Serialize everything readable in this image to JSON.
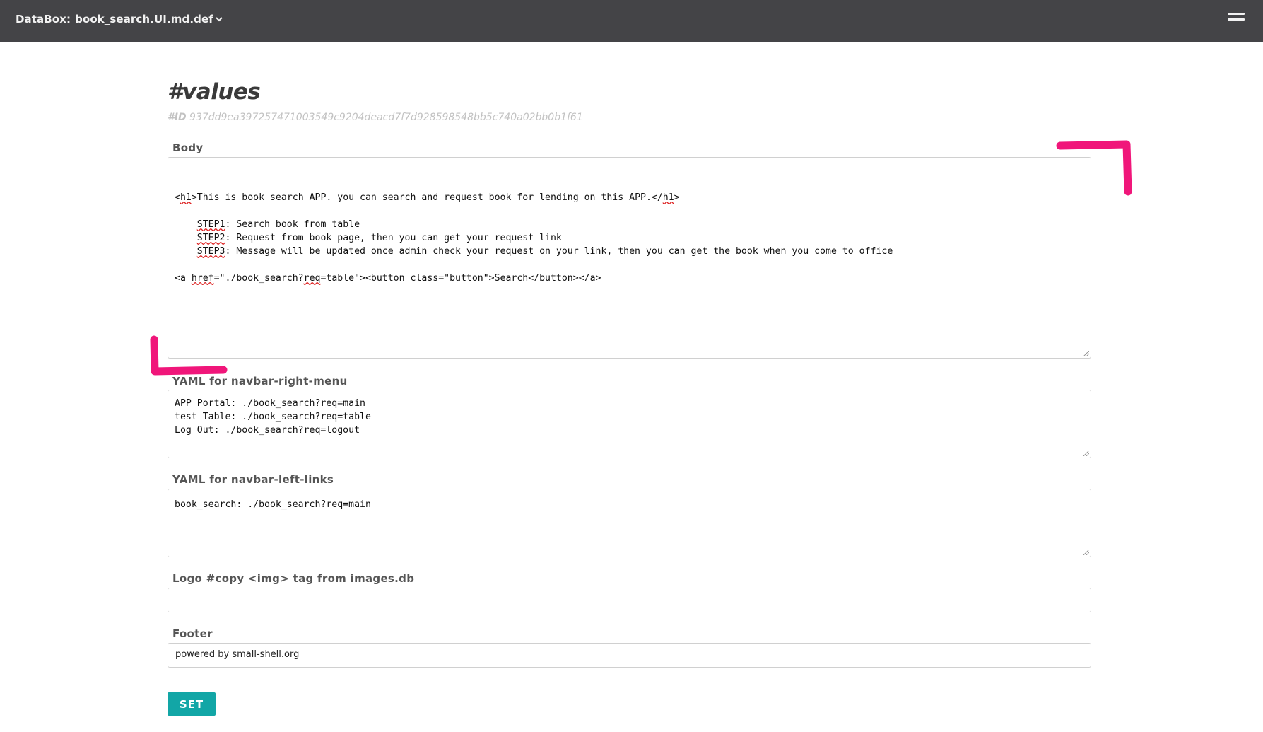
{
  "header": {
    "app_label": "DataBox:",
    "databox_name": "book_search.UI.md.def",
    "caret": "⌄"
  },
  "page": {
    "title": "#values",
    "id_label": "#ID",
    "id_value": "937dd9ea397257471003549c9204deacd7f7d928598548bb5c740a02bb0b1f61"
  },
  "fields": {
    "body": {
      "label": "Body",
      "lines": [
        [
          "<",
          {
            "w": "h1"
          },
          ">This is book search APP. you can search and request book for lending on this APP.</",
          {
            "w": "h1"
          },
          ">"
        ],
        [
          ""
        ],
        [
          "    ",
          {
            "w": "STEP1"
          },
          ": Search book from table"
        ],
        [
          "    ",
          {
            "w": "STEP2"
          },
          ": Request from book page, then you can get your request link"
        ],
        [
          "    ",
          {
            "w": "STEP3"
          },
          ": Message will be updated once admin check your request on your link, then you can get the book when you come to office"
        ],
        [
          ""
        ],
        [
          "<a ",
          {
            "w": "href"
          },
          "=\"./book_search?",
          {
            "w": "req"
          },
          "=table\"><button class=\"button\">Search</button></a>"
        ]
      ]
    },
    "navbar_right": {
      "label": "YAML for navbar-right-menu",
      "value": "APP Portal: ./book_search?req=main\ntest Table: ./book_search?req=table\nLog Out: ./book_search?req=logout"
    },
    "navbar_left": {
      "label": "YAML for navbar-left-links",
      "value": "book_search: ./book_search?req=main"
    },
    "logo": {
      "label": "Logo #copy <img> tag from images.db",
      "value": ""
    },
    "footer": {
      "label": "Footer",
      "value": "powered by small-shell.org"
    }
  },
  "actions": {
    "set_label": "SET"
  },
  "annotation": {
    "color": "#f0167a"
  }
}
